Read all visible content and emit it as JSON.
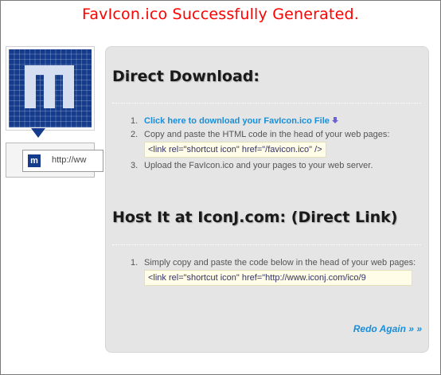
{
  "headline": "FavIcon.ico Successfully Generated.",
  "preview": {
    "icon_letter": "m",
    "address_text": "http://ww"
  },
  "direct_download": {
    "title": "Direct Download:",
    "steps": [
      {
        "num": "1.",
        "link": "Click here to download your FavIcon.ico File"
      },
      {
        "num": "2.",
        "text": "Copy and paste the HTML code in the head of your web pages:",
        "code": "<link rel=\"shortcut icon\" href=\"/favicon.ico\" />"
      },
      {
        "num": "3.",
        "text": "Upload the FavIcon.ico and your pages to your web server."
      }
    ]
  },
  "host": {
    "title": "Host It at IconJ.com: (Direct Link)",
    "steps": [
      {
        "num": "1.",
        "text": "Simply copy and paste the code below in the head of your web pages:",
        "code": "<link rel=\"shortcut icon\" href=\"http://www.iconj.com/ico/9"
      }
    ]
  },
  "redo_label": "Redo Again » »",
  "colors": {
    "headline": "#ff0000",
    "link": "#1a8ed8",
    "icon_blue": "#143b8c",
    "panel": "#e5e5e5"
  }
}
